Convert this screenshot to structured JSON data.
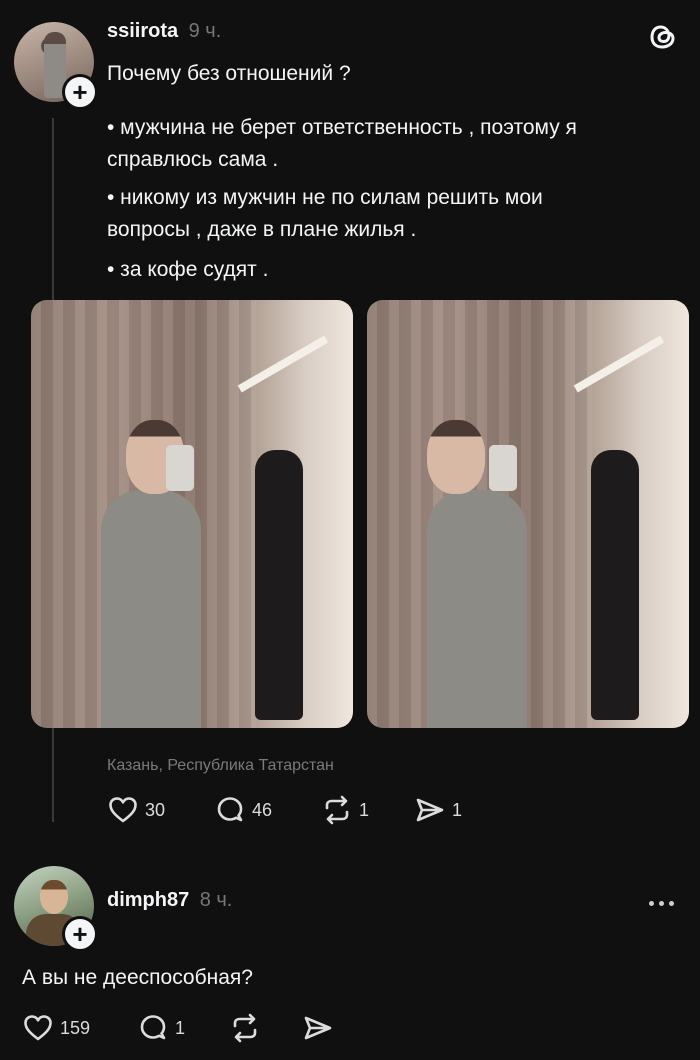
{
  "post": {
    "username": "ssiirota",
    "time": "9 ч.",
    "lines": [
      "Почему без отношений ?",
      "• мужчина не берет ответственность , поэтому я",
      "справлюсь сама .",
      "• никому из мужчин  не по силам решить мои",
      "вопросы , даже в плане жилья .",
      "• за кофе судят ."
    ],
    "location": "Казань, Республика Татарстан",
    "likes": "30",
    "comments": "46",
    "reposts": "1",
    "shares": "1"
  },
  "reply": {
    "username": "dimph87",
    "time": "8 ч.",
    "text": "А вы не дееспособная?",
    "likes": "159",
    "comments": "1"
  },
  "icons": {
    "app": "threads-logo-icon",
    "like": "heart-icon",
    "comment": "comment-bubble-icon",
    "repost": "repost-icon",
    "share": "send-icon",
    "more": "more-dots-icon"
  }
}
